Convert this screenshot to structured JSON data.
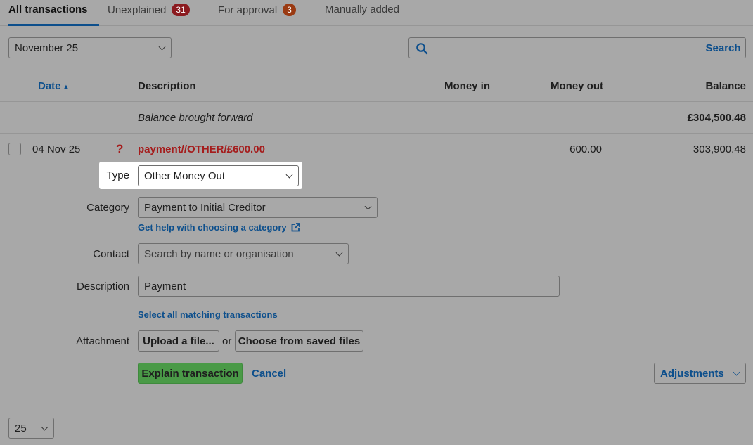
{
  "tabs": [
    {
      "label": "All transactions"
    },
    {
      "label": "Unexplained",
      "badge": "31"
    },
    {
      "label": "For approval",
      "badge": "3"
    },
    {
      "label": "Manually added"
    }
  ],
  "colors": {
    "badge_red": "#8b1a1f",
    "badge_orange": "#9a3a12",
    "accent": "#0d4f8c",
    "explain_green": "#4a9a47",
    "warning_red": "#a51c1c"
  },
  "filter": {
    "period": "November 25"
  },
  "search": {
    "value": "",
    "button": "Search",
    "icon": "search-icon"
  },
  "table": {
    "headers": {
      "date": "Date",
      "description": "Description",
      "money_in": "Money in",
      "money_out": "Money out",
      "balance": "Balance"
    },
    "sort_indicator": "▲",
    "brought_forward": {
      "label": "Balance brought forward",
      "balance": "£304,500.48"
    },
    "row": {
      "date": "04 Nov 25",
      "status": "?",
      "description": "payment//OTHER/£600.00",
      "money_out": "600.00",
      "balance": "303,900.48"
    }
  },
  "form": {
    "type": {
      "label": "Type",
      "value": "Other Money Out"
    },
    "category": {
      "label": "Category",
      "value": "Payment to Initial Creditor",
      "help": "Get help with choosing a category"
    },
    "contact": {
      "label": "Contact",
      "placeholder": "Search by name or organisation"
    },
    "description": {
      "label": "Description",
      "value": "Payment"
    },
    "select_matching": "Select all matching transactions",
    "attachment": {
      "label": "Attachment",
      "upload": "Upload a file...",
      "or": "or",
      "choose": "Choose from saved files"
    },
    "explain_button": "Explain transaction",
    "cancel": "Cancel",
    "adjustments": "Adjustments"
  },
  "pagination": {
    "per_page": "25"
  }
}
